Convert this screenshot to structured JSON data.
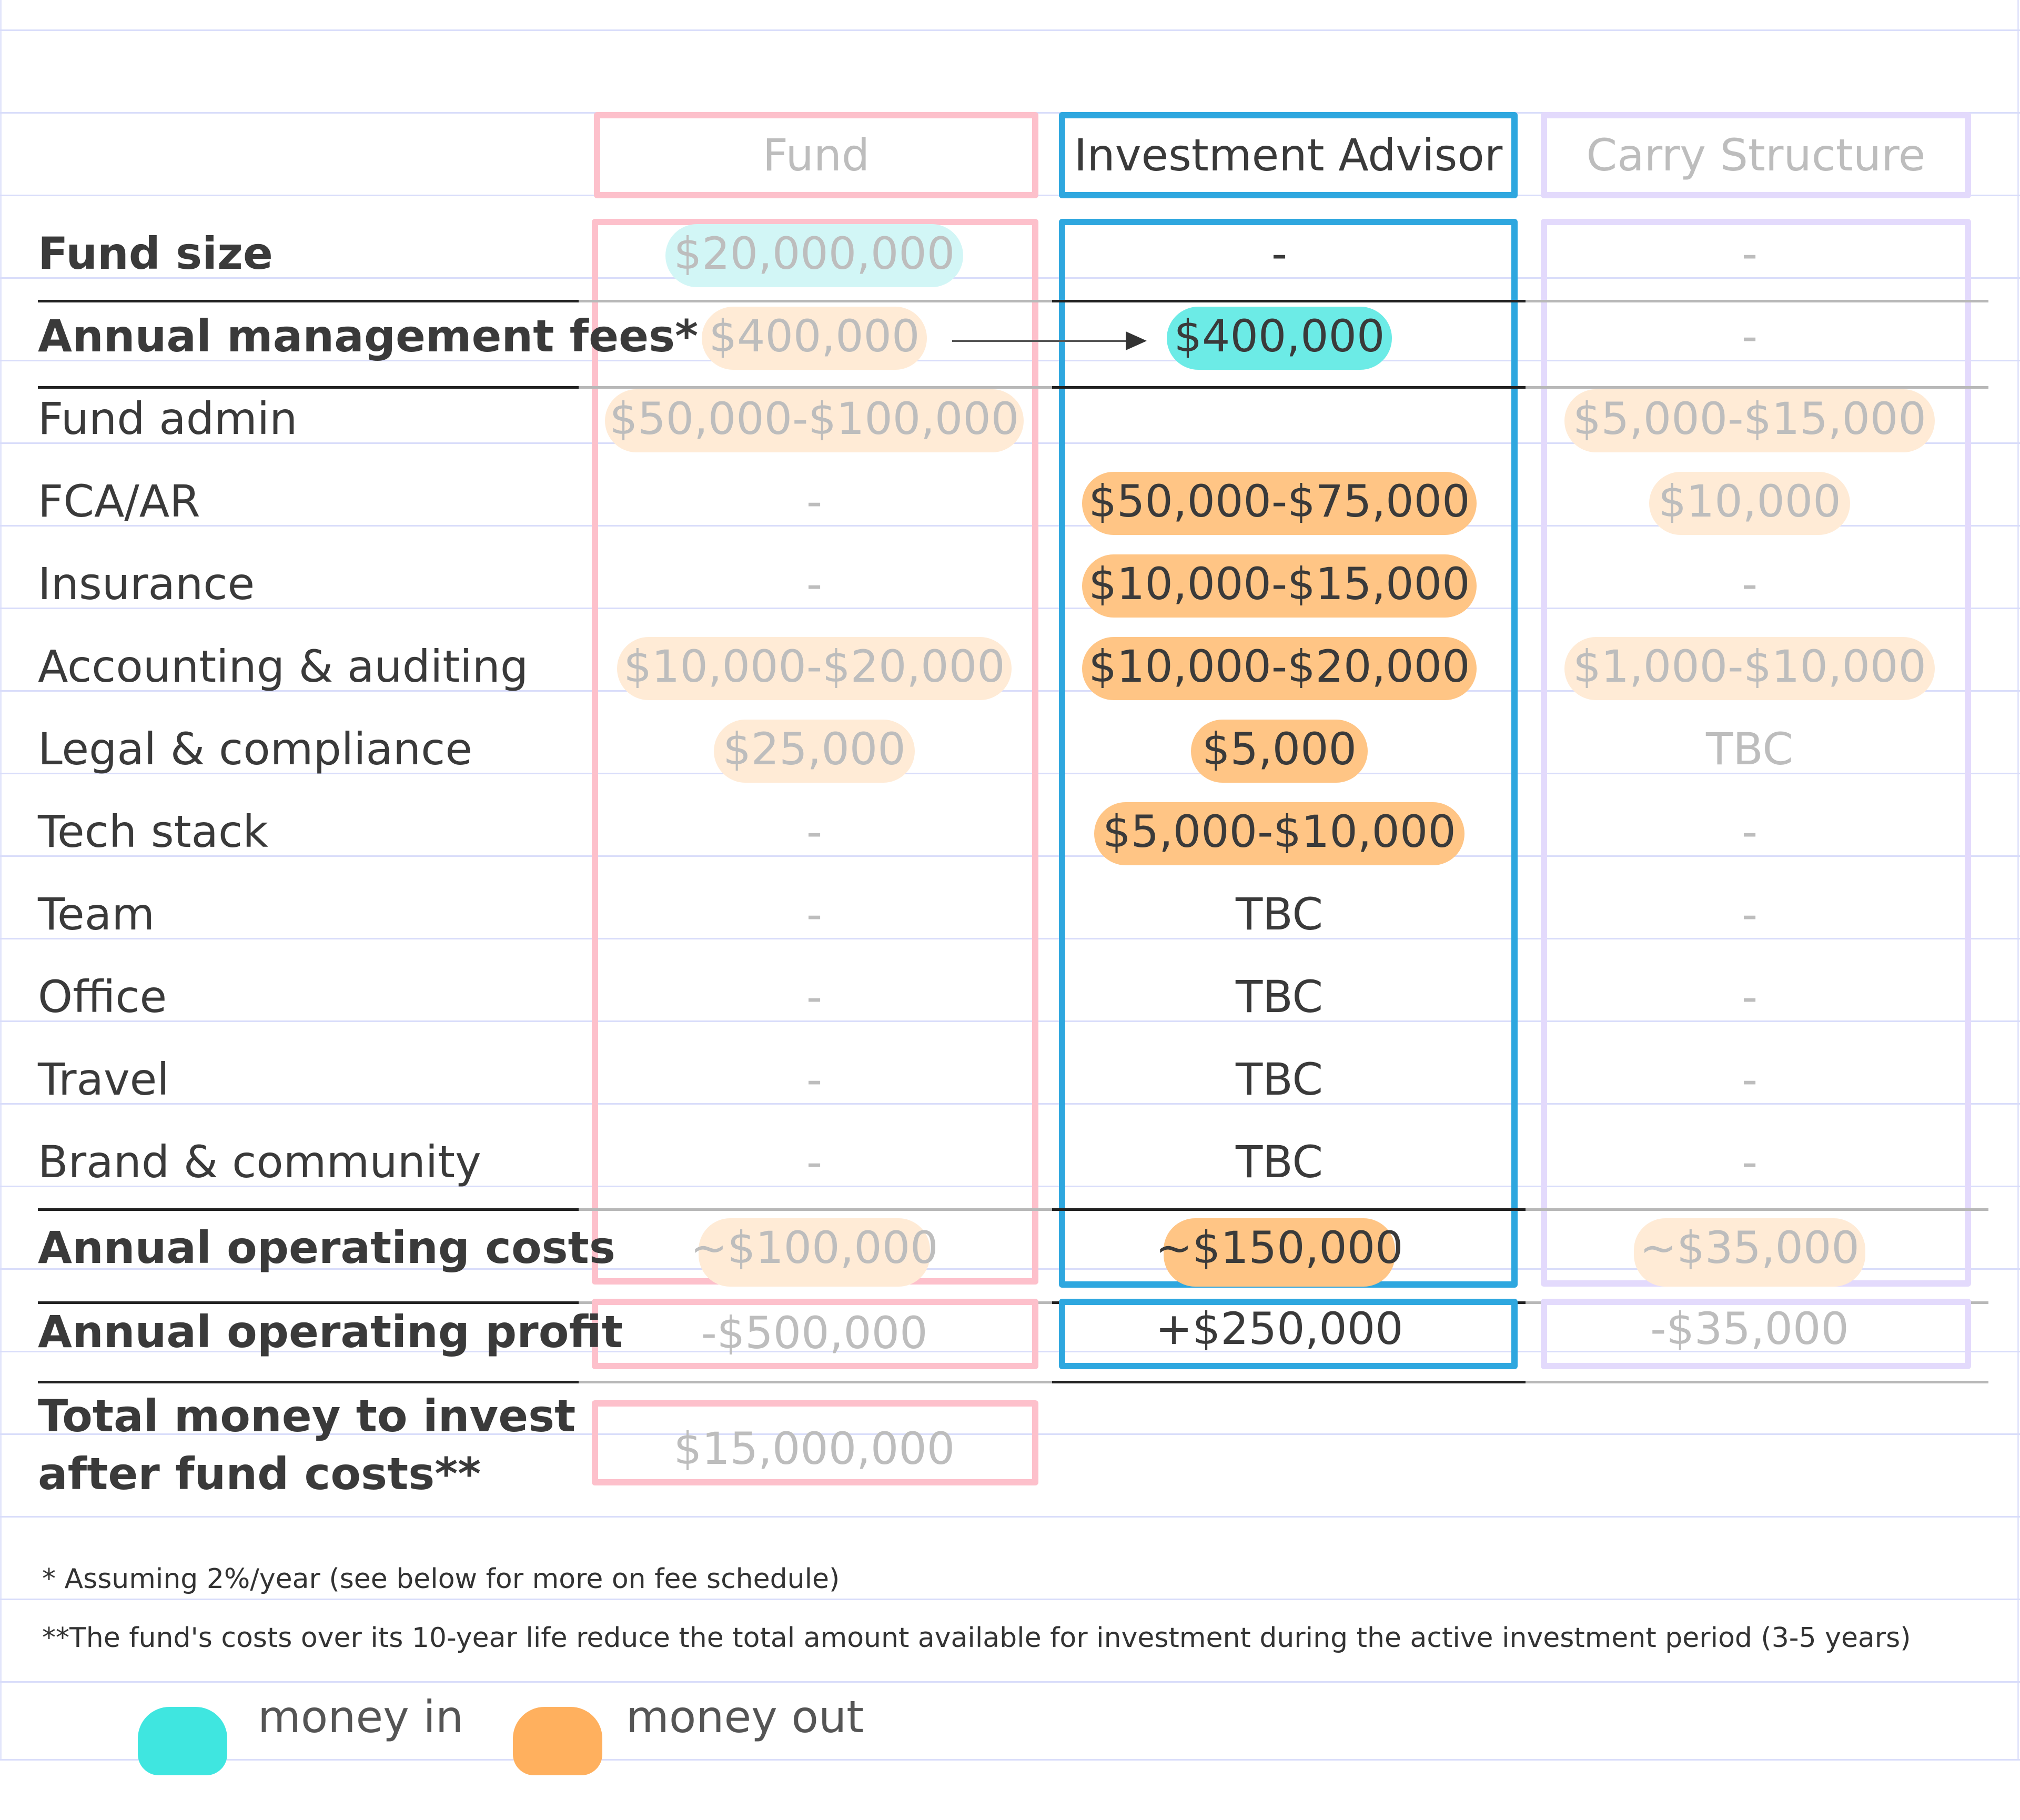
{
  "columns": {
    "fund": {
      "header": "Fund"
    },
    "investment_advisor": {
      "header": "Investment Advisor"
    },
    "carry_structure": {
      "header": "Carry Structure"
    }
  },
  "rows": [
    {
      "label": "Fund size",
      "fund": "$20,000,000",
      "ia": "-",
      "carry": "-"
    },
    {
      "label": "Annual management fees*",
      "fund": "$400,000",
      "ia": "$400,000",
      "carry": "-"
    },
    {
      "label": "Fund admin",
      "fund": "$50,000-$100,000",
      "ia": "",
      "carry": "$5,000-$15,000"
    },
    {
      "label": "FCA/AR",
      "fund": "-",
      "ia": "$50,000-$75,000",
      "carry": "$10,000"
    },
    {
      "label": "Insurance",
      "fund": "-",
      "ia": "$10,000-$15,000",
      "carry": "-"
    },
    {
      "label": "Accounting & auditing",
      "fund": "$10,000-$20,000",
      "ia": "$10,000-$20,000",
      "carry": "$1,000-$10,000"
    },
    {
      "label": "Legal & compliance",
      "fund": "$25,000",
      "ia": "$5,000",
      "carry": "TBC"
    },
    {
      "label": "Tech stack",
      "fund": "-",
      "ia": "$5,000-$10,000",
      "carry": "-"
    },
    {
      "label": "Team",
      "fund": "-",
      "ia": "TBC",
      "carry": "-"
    },
    {
      "label": "Office",
      "fund": "-",
      "ia": "TBC",
      "carry": "-"
    },
    {
      "label": "Travel",
      "fund": "-",
      "ia": "TBC",
      "carry": "-"
    },
    {
      "label": "Brand & community",
      "fund": "-",
      "ia": "TBC",
      "carry": "-"
    }
  ],
  "totals": {
    "operating_costs": {
      "label": "Annual operating costs",
      "fund": "~$100,000",
      "ia": "~$150,000",
      "carry": "~$35,000"
    },
    "operating_profit": {
      "label": "Annual operating profit",
      "fund": "-$500,000",
      "ia": "+$250,000",
      "carry": "-$35,000"
    },
    "total_to_invest": {
      "label_line1": "Total money to invest",
      "label_line2": "after fund costs**",
      "fund": "$15,000,000"
    }
  },
  "footnotes": {
    "single": "* Assuming 2%/year (see below for more on fee schedule)",
    "double": "**The fund's costs over its 10-year life reduce the total amount available for investment during the active investment period (3-5 years)"
  },
  "legend": {
    "money_in": {
      "label": "money in",
      "color": "#3fe6e0"
    },
    "money_out": {
      "label": "money out",
      "color": "#ffb05e"
    }
  },
  "colors": {
    "fund_border": "#fdc0cb",
    "advisor_border": "#2ea7df",
    "carry_border": "#e3dafc",
    "ruled_line": "#d9ddfa"
  }
}
